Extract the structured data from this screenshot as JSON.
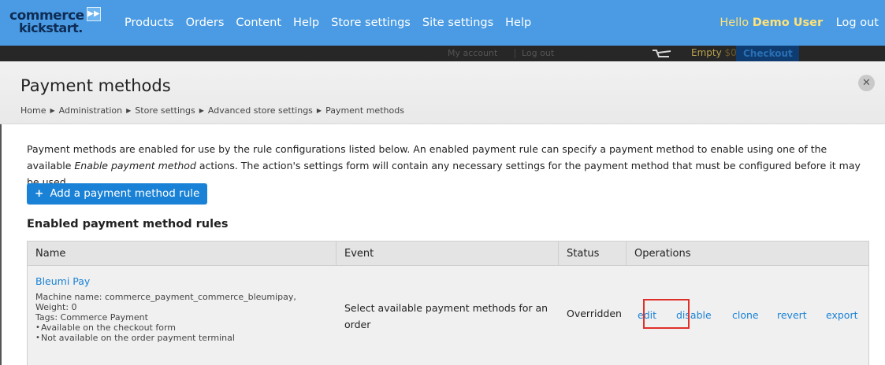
{
  "toolbar": {
    "logo_line1": "commerce",
    "logo_line2": "kickstart.",
    "nav": [
      "Products",
      "Orders",
      "Content",
      "Help",
      "Store settings",
      "Site settings",
      "Help"
    ],
    "hello": "Hello",
    "user_name": "Demo User",
    "logout": "Log out"
  },
  "secondary_bar": {
    "my_account": "My account",
    "log_out": "Log out",
    "cart_empty": "Empty",
    "cart_amount": "$0.00",
    "checkout": "Checkout"
  },
  "page": {
    "title": "Payment methods",
    "breadcrumb": [
      "Home",
      "Administration",
      "Store settings",
      "Advanced store settings",
      "Payment methods"
    ],
    "description_part1": "Payment methods are enabled for use by the rule configurations listed below. An enabled payment rule can specify a payment method to enable using one of the available ",
    "description_em": "Enable payment method",
    "description_part2": " actions. The action's settings form will contain any necessary settings for the payment method that must be configured before it may be used.",
    "add_button": "Add a payment method rule",
    "section_title": "Enabled payment method rules"
  },
  "table": {
    "headers": [
      "Name",
      "Event",
      "Status",
      "Operations"
    ],
    "rows": [
      {
        "name": "Bleumi Pay",
        "machine_name": "Machine name: commerce_payment_commerce_bleumipay,",
        "weight": "Weight: 0",
        "tags": "Tags: Commerce Payment",
        "notes": [
          "Available on the checkout form",
          "Not available on the order payment terminal"
        ],
        "event": "Select available payment methods for an order",
        "status": "Overridden",
        "operations": [
          "edit",
          "disable",
          "clone",
          "revert",
          "export"
        ]
      }
    ]
  },
  "colors": {
    "toolbar": "#4a9be3",
    "link": "#1a82d6",
    "highlight": "#e0302a",
    "user": "#ffe27a"
  }
}
